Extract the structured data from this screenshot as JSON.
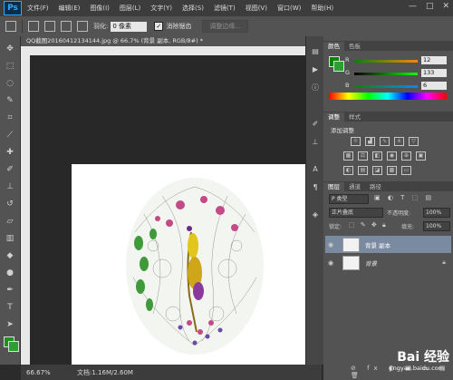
{
  "app": {
    "logo": "Ps"
  },
  "menu": [
    "文件(F)",
    "编辑(E)",
    "图像(I)",
    "图层(L)",
    "文字(Y)",
    "选择(S)",
    "滤镜(T)",
    "视图(V)",
    "窗口(W)",
    "帮助(H)"
  ],
  "window_controls": [
    "—",
    "□",
    "✕"
  ],
  "options_bar": {
    "feather_label": "羽化:",
    "feather_value": "0 像素",
    "antialias_checked": "✓",
    "antialias_label": "消除锯齿",
    "refine_edge_label": "调整边缘..."
  },
  "document": {
    "tab_title": "QQ截图20160412134144.jpg @ 66.7% (背景 副本, RGB/8#) *",
    "zoom": "66.67%",
    "doc_size": "文档:1.16M/2.60M"
  },
  "color_panel": {
    "tabs": [
      "颜色",
      "色板"
    ],
    "r": {
      "label": "R",
      "value": "12"
    },
    "g": {
      "label": "G",
      "value": "133"
    },
    "b": {
      "label": "B",
      "value": "6"
    },
    "foreground": "#0c8506",
    "background": "#2aa12a"
  },
  "adjustments_panel": {
    "tabs": [
      "调整",
      "样式"
    ],
    "title": "添加调整"
  },
  "layers_panel": {
    "tabs": [
      "图层",
      "通道",
      "路径"
    ],
    "kind_label": "P 类型",
    "blend_mode": "正片叠底",
    "opacity_label": "不透明度:",
    "opacity_value": "100%",
    "lock_label": "锁定:",
    "fill_label": "填充:",
    "fill_value": "100%",
    "layers": [
      {
        "name": "背景 副本",
        "selected": true
      },
      {
        "name": "背景",
        "selected": false
      }
    ]
  },
  "watermark": {
    "text": "Bai 经验",
    "url": "jingyan.baidu.com"
  }
}
